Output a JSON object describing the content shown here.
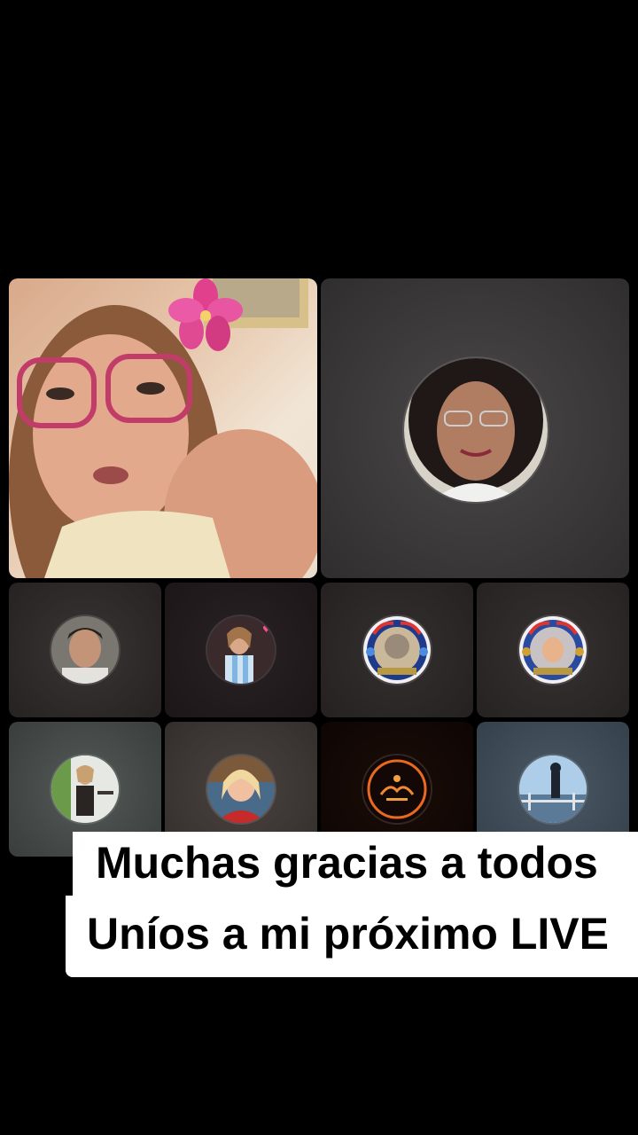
{
  "captions": {
    "line1": "Muchas gracias a todos",
    "line2": "Uníos a mi próximo LIVE"
  },
  "participants": {
    "host": {
      "icon": "host-video-feed"
    },
    "featured": {
      "icon": "guest-avatar"
    },
    "grid": [
      {
        "icon": "guest-avatar"
      },
      {
        "icon": "guest-avatar"
      },
      {
        "icon": "guest-avatar"
      },
      {
        "icon": "guest-avatar"
      },
      {
        "icon": "guest-avatar"
      },
      {
        "icon": "guest-avatar"
      },
      {
        "icon": "guest-avatar"
      },
      {
        "icon": "guest-avatar"
      }
    ]
  },
  "colors": {
    "background": "#000000",
    "caption_bg": "#ffffff",
    "caption_text": "#000000"
  }
}
